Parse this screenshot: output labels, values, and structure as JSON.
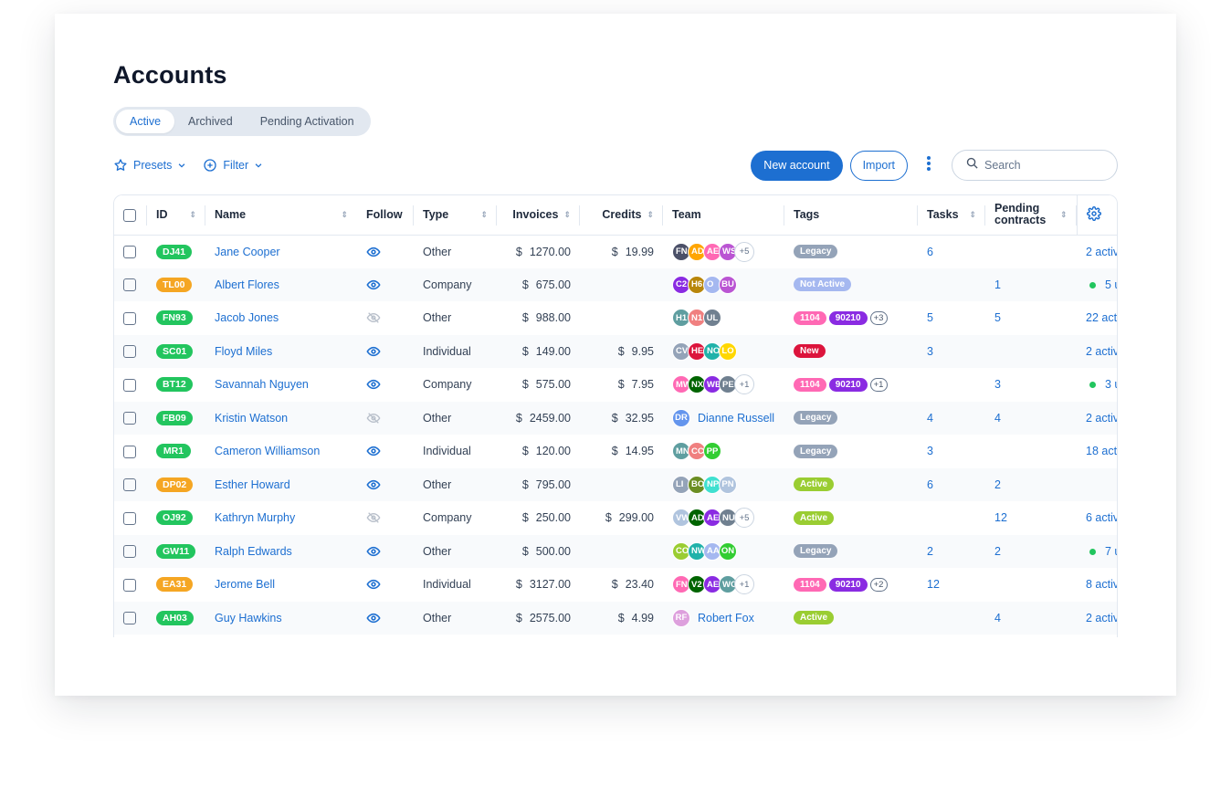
{
  "page": {
    "title": "Accounts",
    "tabs": [
      {
        "label": "Active",
        "active": true
      },
      {
        "label": "Archived",
        "active": false
      },
      {
        "label": "Pending Activation",
        "active": false
      }
    ]
  },
  "toolbar": {
    "presets_label": "Presets",
    "filter_label": "Filter",
    "new_account_label": "New account",
    "import_label": "Import",
    "search_placeholder": "Search",
    "search_value": ""
  },
  "colors": {
    "accent": "#1d6fd1",
    "id_green": "#22c55e",
    "id_orange": "#f5a623",
    "tag_legacy": "#94a3b8",
    "tag_not_active": "#a5b8f0",
    "tag_new": "#dc143c",
    "tag_active": "#9acd32",
    "tag_1104": "#ff69b4",
    "tag_90210": "#8a2be2"
  },
  "table": {
    "columns": {
      "id": "ID",
      "name": "Name",
      "follow": "Follow",
      "type": "Type",
      "invoices": "Invoices",
      "credits": "Credits",
      "team": "Team",
      "tags": "Tags",
      "tasks": "Tasks",
      "pending_contracts_1": "Pending",
      "pending_contracts_2": "contracts"
    },
    "currency": "$",
    "rows": [
      {
        "id": "DJ41",
        "id_color": "green",
        "name": "Jane Cooper",
        "follow": true,
        "type": "Other",
        "invoices": "1270.00",
        "credits": "19.99",
        "team": [
          {
            "i": "FN",
            "c": "#4b5068"
          },
          {
            "i": "AD",
            "c": "#ffa500"
          },
          {
            "i": "AE",
            "c": "#ff69b4"
          },
          {
            "i": "WS",
            "c": "#ba55d3"
          }
        ],
        "team_more": "+5",
        "team_single": null,
        "tags": [
          {
            "t": "Legacy",
            "k": "legacy"
          }
        ],
        "tags_more": null,
        "tasks": "6",
        "pending": "",
        "last": "2 activ",
        "last_dot": false
      },
      {
        "id": "TL00",
        "id_color": "orange",
        "name": "Albert Flores",
        "follow": true,
        "type": "Company",
        "invoices": "675.00",
        "credits": "",
        "team": [
          {
            "i": "C2",
            "c": "#8a2be2"
          },
          {
            "i": "H6",
            "c": "#b8860b"
          },
          {
            "i": "O",
            "c": "#a5b8f0"
          },
          {
            "i": "BU",
            "c": "#ba55d3"
          }
        ],
        "team_more": null,
        "team_single": null,
        "tags": [
          {
            "t": "Not Active",
            "k": "not_active"
          }
        ],
        "tags_more": null,
        "tasks": "",
        "pending": "1",
        "last": "5 u",
        "last_dot": true
      },
      {
        "id": "FN93",
        "id_color": "green",
        "name": "Jacob Jones",
        "follow": false,
        "type": "Other",
        "invoices": "988.00",
        "credits": "",
        "team": [
          {
            "i": "H1",
            "c": "#5f9ea0"
          },
          {
            "i": "N1",
            "c": "#f08080"
          },
          {
            "i": "UL",
            "c": "#708090"
          }
        ],
        "team_more": null,
        "team_single": null,
        "tags": [
          {
            "t": "1104",
            "k": "t1104"
          },
          {
            "t": "90210",
            "k": "t90210"
          }
        ],
        "tags_more": "+3",
        "tasks": "5",
        "pending": "5",
        "last": "22 acti",
        "last_dot": false
      },
      {
        "id": "SC01",
        "id_color": "green",
        "name": "Floyd Miles",
        "follow": true,
        "type": "Individual",
        "invoices": "149.00",
        "credits": "9.95",
        "team": [
          {
            "i": "CV",
            "c": "#94a3b8"
          },
          {
            "i": "HE",
            "c": "#dc143c"
          },
          {
            "i": "NO",
            "c": "#20b2aa"
          },
          {
            "i": "LO",
            "c": "#ffd700"
          }
        ],
        "team_more": null,
        "team_single": null,
        "tags": [
          {
            "t": "New",
            "k": "new"
          }
        ],
        "tags_more": null,
        "tasks": "3",
        "pending": "",
        "last": "2 activ",
        "last_dot": false
      },
      {
        "id": "BT12",
        "id_color": "green",
        "name": "Savannah Nguyen",
        "follow": true,
        "type": "Company",
        "invoices": "575.00",
        "credits": "7.95",
        "team": [
          {
            "i": "MW",
            "c": "#ff69b4"
          },
          {
            "i": "NX",
            "c": "#006400"
          },
          {
            "i": "WE",
            "c": "#8a2be2"
          },
          {
            "i": "PE",
            "c": "#708090"
          }
        ],
        "team_more": "+1",
        "team_single": null,
        "tags": [
          {
            "t": "1104",
            "k": "t1104"
          },
          {
            "t": "90210",
            "k": "t90210"
          }
        ],
        "tags_more": "+1",
        "tasks": "",
        "pending": "3",
        "last": "3 u",
        "last_dot": true
      },
      {
        "id": "FB09",
        "id_color": "green",
        "name": "Kristin Watson",
        "follow": false,
        "type": "Other",
        "invoices": "2459.00",
        "credits": "32.95",
        "team": [],
        "team_more": null,
        "team_single": {
          "i": "DR",
          "c": "#6495ed",
          "name": "Dianne Russell"
        },
        "tags": [
          {
            "t": "Legacy",
            "k": "legacy"
          }
        ],
        "tags_more": null,
        "tasks": "4",
        "pending": "4",
        "last": "2 activ",
        "last_dot": false
      },
      {
        "id": "MR1",
        "id_color": "green",
        "name": "Cameron Williamson",
        "follow": true,
        "type": "Individual",
        "invoices": "120.00",
        "credits": "14.95",
        "team": [
          {
            "i": "MN",
            "c": "#5f9ea0"
          },
          {
            "i": "CC",
            "c": "#f08080"
          },
          {
            "i": "PP",
            "c": "#32cd32"
          }
        ],
        "team_more": null,
        "team_single": null,
        "tags": [
          {
            "t": "Legacy",
            "k": "legacy"
          }
        ],
        "tags_more": null,
        "tasks": "3",
        "pending": "",
        "last": "18 acti",
        "last_dot": false
      },
      {
        "id": "DP02",
        "id_color": "orange",
        "name": "Esther Howard",
        "follow": true,
        "type": "Other",
        "invoices": "795.00",
        "credits": "",
        "team": [
          {
            "i": "LI",
            "c": "#94a3b8"
          },
          {
            "i": "BO",
            "c": "#6b8e23"
          },
          {
            "i": "NP",
            "c": "#40e0d0"
          },
          {
            "i": "PN",
            "c": "#b0c4de"
          }
        ],
        "team_more": null,
        "team_single": null,
        "tags": [
          {
            "t": "Active",
            "k": "active"
          }
        ],
        "tags_more": null,
        "tasks": "6",
        "pending": "2",
        "last": "",
        "last_dot": false
      },
      {
        "id": "OJ92",
        "id_color": "green",
        "name": "Kathryn Murphy",
        "follow": false,
        "type": "Company",
        "invoices": "250.00",
        "credits": "299.00",
        "team": [
          {
            "i": "VW",
            "c": "#b0c4de"
          },
          {
            "i": "AD",
            "c": "#006400"
          },
          {
            "i": "AE",
            "c": "#8a2be2"
          },
          {
            "i": "NU",
            "c": "#708090"
          }
        ],
        "team_more": "+5",
        "team_single": null,
        "tags": [
          {
            "t": "Active",
            "k": "active"
          }
        ],
        "tags_more": null,
        "tasks": "",
        "pending": "12",
        "last": "6 activ",
        "last_dot": false
      },
      {
        "id": "GW11",
        "id_color": "green",
        "name": "Ralph Edwards",
        "follow": true,
        "type": "Other",
        "invoices": "500.00",
        "credits": "",
        "team": [
          {
            "i": "CO",
            "c": "#9acd32"
          },
          {
            "i": "NW",
            "c": "#20b2aa"
          },
          {
            "i": "AA",
            "c": "#a5b8f0"
          },
          {
            "i": "ON",
            "c": "#32cd32"
          }
        ],
        "team_more": null,
        "team_single": null,
        "tags": [
          {
            "t": "Legacy",
            "k": "legacy"
          }
        ],
        "tags_more": null,
        "tasks": "2",
        "pending": "2",
        "last": "7 u",
        "last_dot": true
      },
      {
        "id": "EA31",
        "id_color": "orange",
        "name": "Jerome Bell",
        "follow": true,
        "type": "Individual",
        "invoices": "3127.00",
        "credits": "23.40",
        "team": [
          {
            "i": "FN",
            "c": "#ff69b4"
          },
          {
            "i": "V2",
            "c": "#006400"
          },
          {
            "i": "AE",
            "c": "#8a2be2"
          },
          {
            "i": "WO",
            "c": "#5f9ea0"
          }
        ],
        "team_more": "+1",
        "team_single": null,
        "tags": [
          {
            "t": "1104",
            "k": "t1104"
          },
          {
            "t": "90210",
            "k": "t90210"
          }
        ],
        "tags_more": "+2",
        "tasks": "12",
        "pending": "",
        "last": "8 activ",
        "last_dot": false
      },
      {
        "id": "AH03",
        "id_color": "green",
        "name": "Guy Hawkins",
        "follow": true,
        "type": "Other",
        "invoices": "2575.00",
        "credits": "4.99",
        "team": [],
        "team_more": null,
        "team_single": {
          "i": "RF",
          "c": "#dda0dd",
          "name": "Robert Fox"
        },
        "tags": [
          {
            "t": "Active",
            "k": "active"
          }
        ],
        "tags_more": null,
        "tasks": "",
        "pending": "4",
        "last": "2 activ",
        "last_dot": false
      }
    ]
  }
}
